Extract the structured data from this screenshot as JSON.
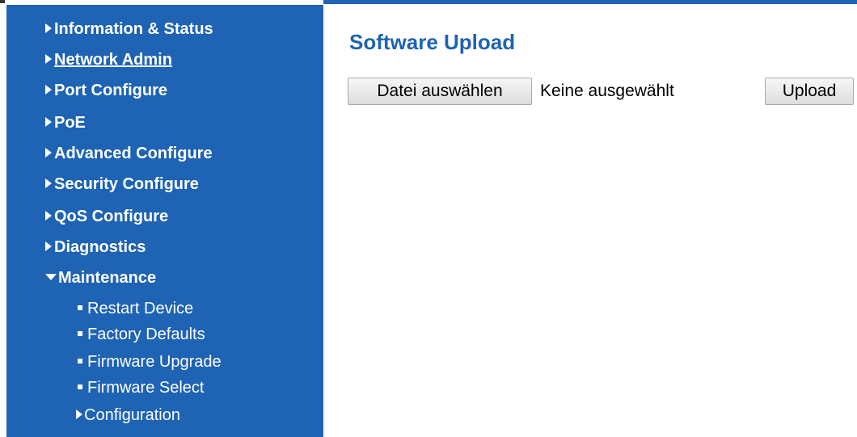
{
  "sidebar": {
    "items": [
      {
        "label": "Information & Status"
      },
      {
        "label": "Network Admin"
      },
      {
        "label": "Port Configure"
      },
      {
        "label": "PoE"
      },
      {
        "label": "Advanced Configure"
      },
      {
        "label": "Security Configure"
      },
      {
        "label": "QoS Configure"
      },
      {
        "label": "Diagnostics"
      },
      {
        "label": "Maintenance"
      }
    ],
    "maintenance_sub": [
      {
        "label": "Restart Device"
      },
      {
        "label": "Factory Defaults"
      },
      {
        "label": "Firmware Upgrade"
      },
      {
        "label": "Firmware Select"
      },
      {
        "label": "Configuration"
      }
    ]
  },
  "main": {
    "title": "Software Upload",
    "choose_file_label": "Datei auswählen",
    "file_status": "Keine ausgewählt",
    "upload_label": "Upload"
  },
  "colors": {
    "sidebar_bg": "#1e63b4",
    "title": "#1e63b4"
  }
}
